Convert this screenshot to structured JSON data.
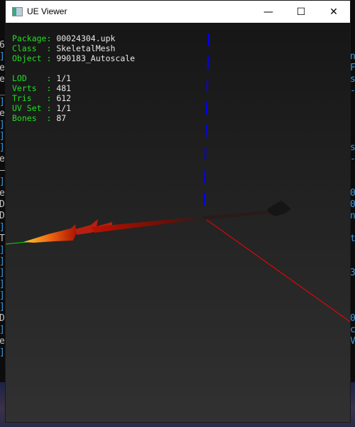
{
  "window": {
    "title": "UE Viewer",
    "minimize": "—",
    "maximize": "☐",
    "close": "✕"
  },
  "info": {
    "package": {
      "label": "Package:",
      "value": "00024304.upk"
    },
    "class": {
      "label": "Class  :",
      "value": "SkeletalMesh"
    },
    "object": {
      "label": "Object :",
      "value": "990183_Autoscale"
    },
    "lod": {
      "label": "LOD    :",
      "value": "1/1"
    },
    "verts": {
      "label": "Verts  :",
      "value": "481"
    },
    "tris": {
      "label": "Tris   :",
      "value": "612"
    },
    "uvset": {
      "label": "UV Set :",
      "value": "1/1"
    },
    "bones": {
      "label": "Bones  :",
      "value": "87"
    }
  },
  "console_left": [
    "6",
    "]",
    "e",
    "e",
    "_",
    "]",
    "e",
    "]",
    "]",
    "]",
    "e",
    "—",
    "]",
    "e",
    "D",
    "D",
    "]",
    "T",
    "]",
    "]",
    "]",
    "]",
    "]",
    "]",
    "D",
    "]",
    "e",
    "]"
  ],
  "console_right": [
    "n",
    "F",
    "s",
    "-",
    "",
    "",
    "",
    "",
    "s",
    "-",
    "",
    "",
    "0",
    "0",
    "n",
    "",
    "t",
    "",
    "",
    "3",
    "",
    "",
    "",
    "0",
    "c",
    "V"
  ],
  "colors": {
    "axis_x": "#ff0000",
    "axis_y": "#00dd00",
    "axis_z": "#0000ff",
    "label": "#22dd22"
  }
}
